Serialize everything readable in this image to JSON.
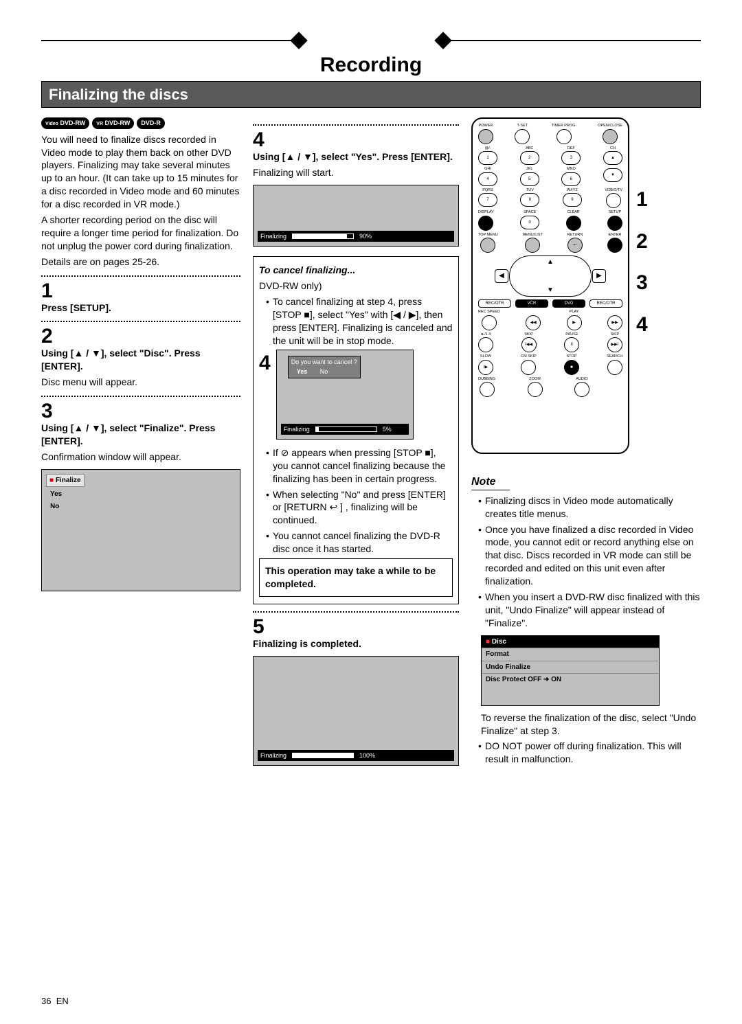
{
  "header": {
    "title": "Recording",
    "subtitle": "Finalizing the discs"
  },
  "badges": [
    "DVD-RW",
    "DVD-RW",
    "DVD-R"
  ],
  "badge_sup": [
    "Video",
    "VR",
    ""
  ],
  "col1": {
    "intro1": "You will need to finalize discs recorded in Video mode to play them back on other DVD players. Finalizing may take several minutes up to an hour. (It can take up to 15 minutes for a disc recorded in Video mode and 60 minutes for a disc recorded in VR mode.)",
    "intro2": "A shorter recording period on the disc will require a longer time period for finalization. Do not unplug the power cord during finalization.",
    "intro3": "Details are on pages 25-26.",
    "s1num": "1",
    "s1b": "Press [SETUP].",
    "s2num": "2",
    "s2b": "Using [▲ / ▼], select \"Disc\". Press [ENTER].",
    "s2p": "Disc menu will appear.",
    "s3num": "3",
    "s3b": "Using [▲ / ▼], select \"Finalize\". Press [ENTER].",
    "s3p": "Confirmation window will appear.",
    "osd3": {
      "title": "Finalize",
      "opt1": "Yes",
      "opt2": "No"
    }
  },
  "col2": {
    "s4num": "4",
    "s4b": "Using [▲ / ▼], select \"Yes\". Press [ENTER].",
    "s4p": "Finalizing will start.",
    "osd4": {
      "status": "Finalizing",
      "pct": "90%",
      "fill": 90
    },
    "cancel_hd": "To cancel finalizing...",
    "cancel_sub": "DVD-RW only)",
    "cancel_b": "To cancel finalizing at step 4, press [STOP ■], select \"Yes\" with [◀ / ▶], then press [ENTER]. Finalizing is canceled and the unit will be in stop mode.",
    "cancel_left_num": "4",
    "osd_cancel": {
      "q": "Do you want to cancel ?",
      "yes": "Yes",
      "no": "No",
      "status": "Finalizing",
      "pct": "5%",
      "fill": 5
    },
    "bul1": "If  ⊘  appears when pressing [STOP ■], you cannot cancel finalizing because the finalizing has been in certain progress.",
    "bul2": "When selecting \"No\" and press [ENTER] or [RETURN  ↩ ] , finalizing will be continued.",
    "bul3": "You cannot cancel finalizing the DVD-R disc once it has started.",
    "frame": "This operation may take a while to be completed.",
    "s5num": "5",
    "s5b": "Finalizing is completed.",
    "osd5": {
      "status": "Finalizing",
      "pct": "100%",
      "fill": 100
    }
  },
  "col3": {
    "side": [
      "1",
      "2",
      "3",
      "4"
    ],
    "note_hd": "Note",
    "nb1": "Finalizing discs in Video mode automatically creates title menus.",
    "nb2": "Once you have finalized a disc recorded in Video mode, you cannot edit or record anything else on that disc. Discs recorded in VR mode can still be recorded and edited on this unit even after finalization.",
    "nb3": "When you insert a DVD-RW disc finalized with this unit, \"Undo Finalize\" will appear instead of \"Finalize\".",
    "osd_menu": {
      "title": "Disc",
      "it1": "Format",
      "it2": "Undo Finalize",
      "it3": "Disc Protect OFF ➜ ON"
    },
    "nb3b": "To reverse the finalization of the disc, select \"Undo Finalize\" at step 3.",
    "nb4": "DO NOT power off during finalization. This will result in malfunction."
  },
  "remote_labels": {
    "r1": [
      "POWER",
      "T-SET",
      "TIMER PROG.",
      "OPEN/CLOSE"
    ],
    "r2": [
      "@/.",
      "ABC",
      "DEF",
      "CH"
    ],
    "r3": [
      "GHI",
      "JKL",
      "MNO",
      ""
    ],
    "r4": [
      "PQRS",
      "TUV",
      "WXYZ",
      "VIDEO/TV"
    ],
    "r5": [
      "DISPLAY",
      "SPACE",
      "CLEAR",
      "SETUP"
    ],
    "r6": [
      "TOP MENU",
      "MENU/LIST",
      "RETURN",
      "ENTER"
    ],
    "mode": [
      "REC/OTR",
      "VCR",
      "DVD",
      "REC/OTR"
    ],
    "r7": [
      "REC SPEED",
      "",
      "PLAY",
      ""
    ],
    "r8": [
      "►/1.3",
      "SKIP",
      "PAUSE",
      "SKIP"
    ],
    "r9": [
      "SLOW",
      "CM SKIP",
      "STOP",
      "SEARCH"
    ],
    "r10": [
      "DUBBING",
      "ZOOM",
      "AUDIO",
      ""
    ]
  },
  "footer": {
    "page": "36",
    "lang": "EN"
  }
}
